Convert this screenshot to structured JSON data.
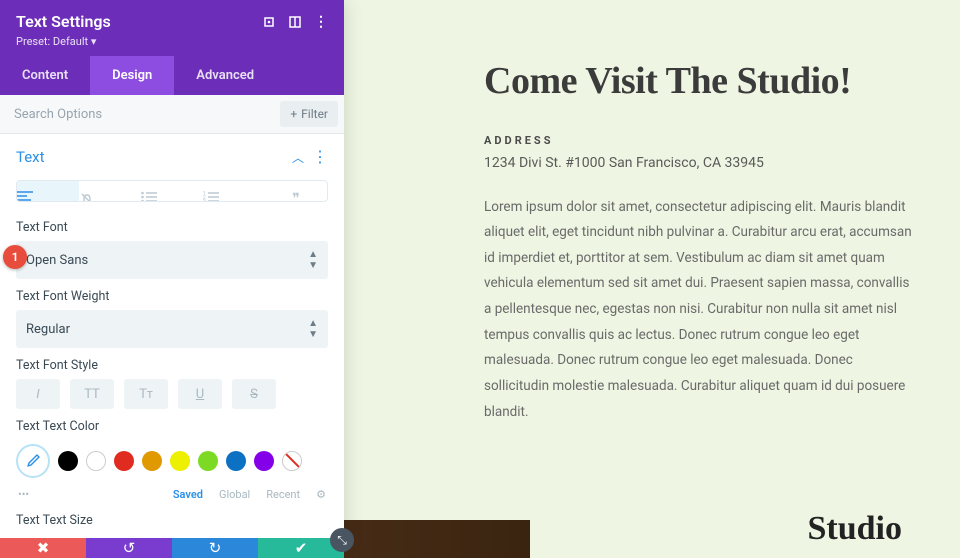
{
  "panel": {
    "title": "Text Settings",
    "preset": "Preset: Default ▾",
    "tabs": {
      "content": "Content",
      "design": "Design",
      "advanced": "Advanced"
    },
    "search_placeholder": "Search Options",
    "filter_label": "Filter",
    "section_title": "Text",
    "field_font": "Text Font",
    "font_value": "Open Sans",
    "field_weight": "Text Font Weight",
    "weight_value": "Regular",
    "field_style": "Text Font Style",
    "style_btns": {
      "italic": "I",
      "uppercase": "TT",
      "smallcaps": "Tᴛ",
      "underline": "U",
      "strike": "S"
    },
    "field_color": "Text Text Color",
    "color_tabs": {
      "saved": "Saved",
      "global": "Global",
      "recent": "Recent"
    },
    "field_size": "Text Text Size",
    "marker": "1"
  },
  "preview": {
    "headline": "Come Visit The Studio!",
    "address_label": "ADDRESS",
    "address": "1234 Divi St. #1000 San Francisco, CA 33945",
    "body": "Lorem ipsum dolor sit amet, consectetur adipiscing elit. Mauris blandit aliquet elit, eget tincidunt nibh pulvinar a. Curabitur arcu erat, accumsan id imperdiet et, porttitor at sem. Vestibulum ac diam sit amet quam vehicula elementum sed sit amet dui. Praesent sapien massa, convallis a pellentesque nec, egestas non nisi. Curabitur non nulla sit amet nisl tempus convallis quis ac lectus. Donec rutrum congue leo eget malesuada. Donec rutrum congue leo eget malesuada. Donec sollicitudin molestie malesuada. Curabitur aliquet quam id dui posuere blandit.",
    "studio": "Studio"
  }
}
